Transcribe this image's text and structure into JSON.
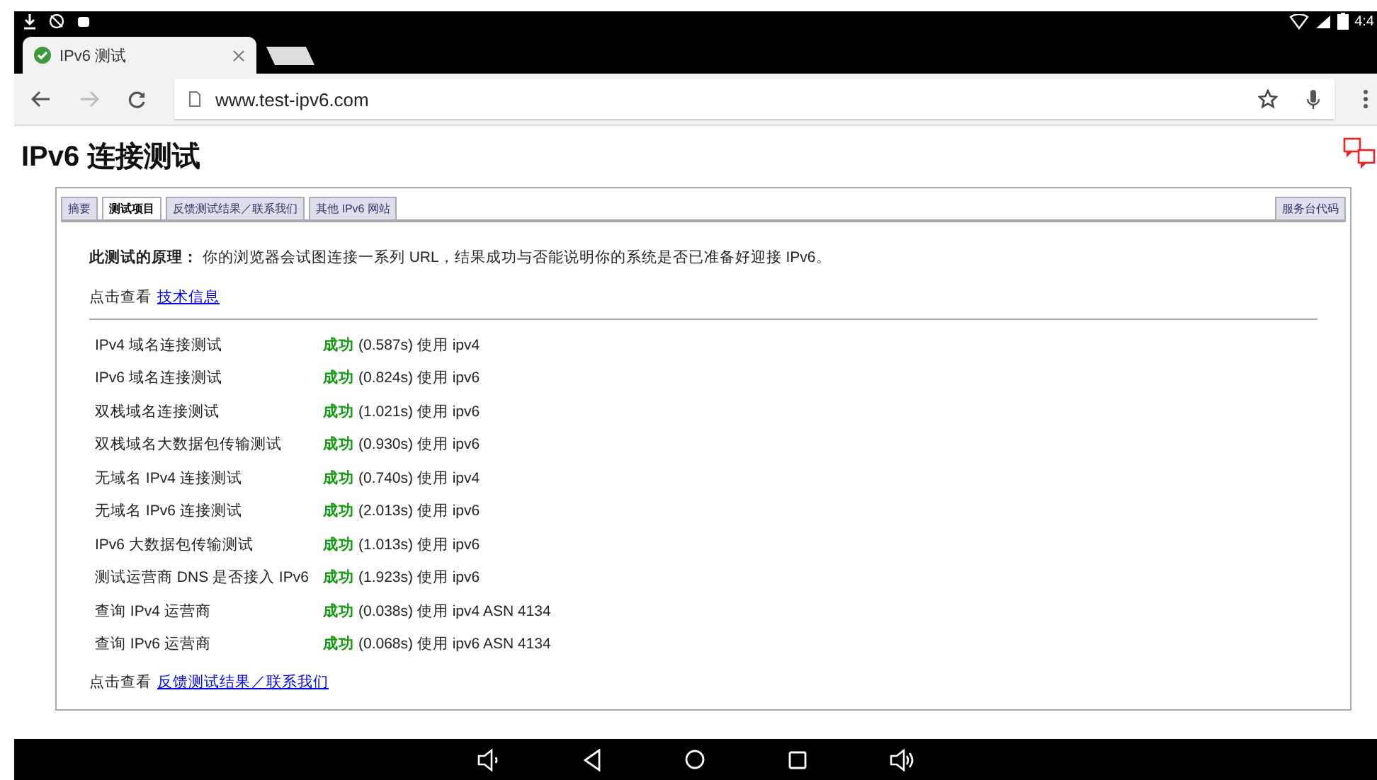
{
  "status_bar": {
    "time": "4:4"
  },
  "browser": {
    "tabs": [
      {
        "title": "IPv6 测试",
        "selected": true
      }
    ],
    "address": "www.test-ipv6.com"
  },
  "page": {
    "title": "IPv6 连接测试",
    "tabs": [
      {
        "label": "摘要",
        "selected": false
      },
      {
        "label": "测试项目",
        "selected": true
      },
      {
        "label": "反馈测试结果／联系我们",
        "selected": false
      },
      {
        "label": "其他 IPv6 网站",
        "selected": false
      }
    ],
    "side_tab": {
      "label": "服务台代码",
      "selected": false
    },
    "intro": "**此测试的原理：** 你的浏览器会试图连接一系列 URL，结果成功与否能说明你的系统是否已准备好迎接 IPv6。",
    "info": {
      "prefix": "点击查看",
      "link": "技术信息"
    },
    "tests": [
      {
        "name": "IPv4 域名连接测试",
        "kind": "success",
        "status": "成功",
        "detail": "(0.587s) 使用 ipv4"
      },
      {
        "name": "IPv6 域名连接测试",
        "kind": "success",
        "status": "成功",
        "detail": "(0.824s) 使用 ipv6"
      },
      {
        "name": "双栈域名连接测试",
        "kind": "success",
        "status": "成功",
        "detail": "(1.021s) 使用 ipv6"
      },
      {
        "name": "双栈域名大数据包传输测试",
        "kind": "success",
        "status": "成功",
        "detail": "(0.930s) 使用 ipv6"
      },
      {
        "name": "无域名 IPv4 连接测试",
        "kind": "success",
        "status": "成功",
        "detail": "(0.740s) 使用 ipv4"
      },
      {
        "name": "无域名 IPv6 连接测试",
        "kind": "success",
        "status": "成功",
        "detail": "(2.013s) 使用 ipv6"
      },
      {
        "name": "IPv6 大数据包传输测试",
        "kind": "success",
        "status": "成功",
        "detail": "(1.013s) 使用 ipv6"
      },
      {
        "name": "测试运营商 DNS 是否接入 IPv6",
        "kind": "success",
        "status": "成功",
        "detail": "(1.923s) 使用 ipv6"
      },
      {
        "name": "查询 IPv4 运营商",
        "kind": "success",
        "status": "成功",
        "detail": "(0.038s) 使用 ipv4 ASN 4134"
      },
      {
        "name": "查询 IPv6 运营商",
        "kind": "success",
        "status": "成功",
        "detail": "(0.068s) 使用 ipv6 ASN 4134"
      }
    ],
    "feedback": {
      "prefix": "点击查看",
      "link": "反馈测试结果／联系我们"
    }
  }
}
